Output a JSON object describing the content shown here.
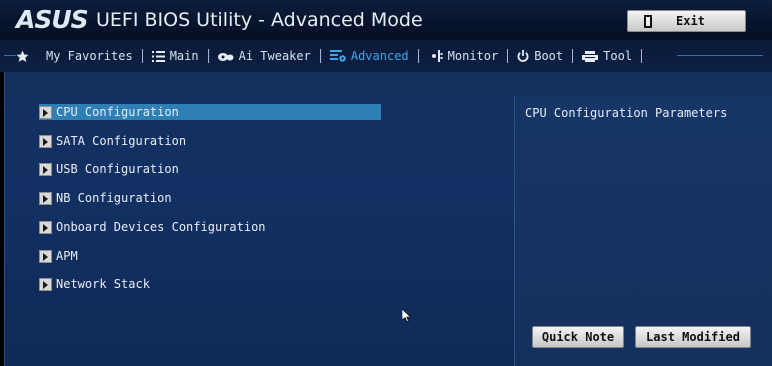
{
  "header": {
    "brand": "ASUS",
    "title": "UEFI BIOS Utility - Advanced Mode",
    "exit_label": "Exit"
  },
  "nav": {
    "tabs": [
      {
        "label": "My Favorites",
        "icon": "star-icon",
        "active": false
      },
      {
        "label": "Main",
        "icon": "list-icon",
        "active": false
      },
      {
        "label": "Ai Tweaker",
        "icon": "tweaker-icon",
        "active": false
      },
      {
        "label": "Advanced",
        "icon": "advanced-icon",
        "active": true
      },
      {
        "label": "Monitor",
        "icon": "monitor-icon",
        "active": false
      },
      {
        "label": "Boot",
        "icon": "power-icon",
        "active": false
      },
      {
        "label": "Tool",
        "icon": "printer-icon",
        "active": false
      }
    ]
  },
  "menu": {
    "items": [
      {
        "label": "CPU Configuration",
        "selected": true
      },
      {
        "label": "SATA Configuration",
        "selected": false
      },
      {
        "label": "USB Configuration",
        "selected": false
      },
      {
        "label": "NB Configuration",
        "selected": false
      },
      {
        "label": "Onboard Devices Configuration",
        "selected": false
      },
      {
        "label": "APM",
        "selected": false
      },
      {
        "label": "Network Stack",
        "selected": false
      }
    ]
  },
  "help": {
    "text": "CPU Configuration Parameters"
  },
  "buttons": {
    "quick_note": "Quick Note",
    "last_modified": "Last Modified"
  },
  "colors": {
    "accent": "#3aa7e8",
    "selection": "#2f7fb7",
    "panel": "#13305e"
  }
}
